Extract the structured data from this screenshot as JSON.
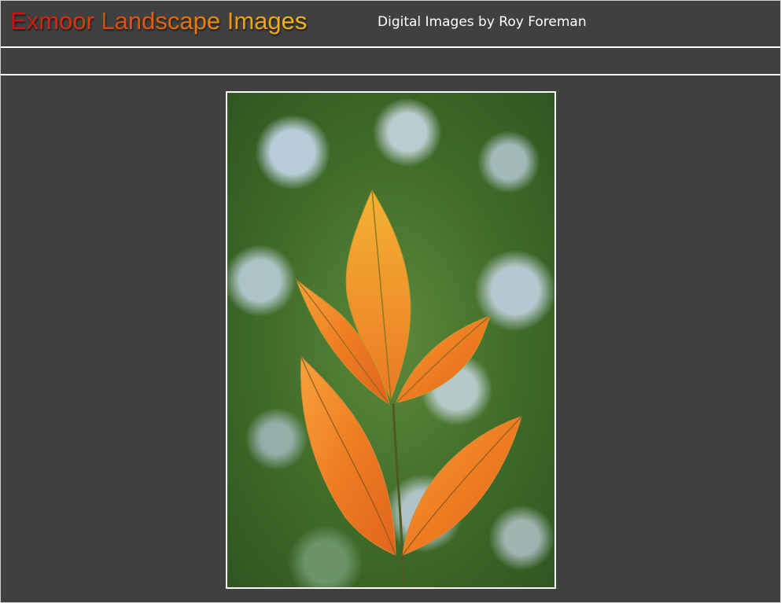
{
  "header": {
    "site_title": "Exmoor Landscape Images",
    "subtitle": "Digital Images by Roy Foreman"
  },
  "colors": {
    "background": "#404040",
    "rule": "#ffffff",
    "title_gradient_start": "#cc1010",
    "title_gradient_end": "#f2bc14",
    "subtitle_text": "#ffffff"
  },
  "photo": {
    "subject": "orange-leaves-against-green-bokeh",
    "icon": "photo-image"
  }
}
